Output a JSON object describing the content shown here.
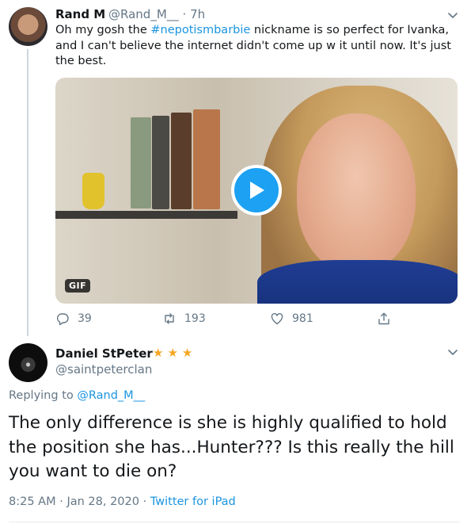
{
  "tweet": {
    "author_name": "Rand M",
    "author_handle": "@Rand_M__",
    "separator": " · ",
    "time": "7h",
    "text_before": "Oh my gosh the ",
    "hashtag": "#nepotismbarbie",
    "text_after": " nickname is so perfect for Ivanka, and I can't believe the internet didn't come up w it until now. It's just the best.",
    "media_badge": "GIF",
    "reply_count": "39",
    "retweet_count": "193",
    "like_count": "981",
    "icons": {
      "reply": "reply-icon",
      "retweet": "retweet-icon",
      "like": "heart-icon",
      "share": "share-icon",
      "menu": "chevron-down-icon",
      "play": "play-icon"
    }
  },
  "reply": {
    "author_name": "Daniel StPeter",
    "stars": [
      "★",
      "★",
      "★"
    ],
    "author_handle": "@saintpeterclan",
    "replying_prefix": "Replying to ",
    "replying_to": "@Rand_M__",
    "text": "The only difference is she is highly qualified to hold the position she has...Hunter??? Is this really the hill you want to die on?",
    "time": "8:25 AM",
    "date": "Jan 28, 2020",
    "separator": " · ",
    "source": "Twitter for iPad"
  },
  "colors": {
    "accent": "#1da1f2",
    "link": "#1b95e0",
    "muted": "#657786",
    "star": "#f5a623"
  }
}
